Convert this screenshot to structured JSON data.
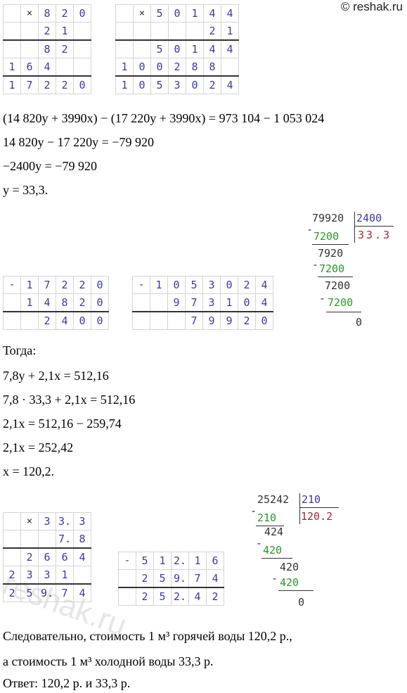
{
  "watermark": "© reshak.ru",
  "watermark_diag": "reshak.ru",
  "mult1": {
    "rows": [
      [
        "",
        "×",
        "8",
        "2",
        "0"
      ],
      [
        "",
        "",
        "2",
        "1",
        ""
      ],
      [
        "",
        "",
        "8",
        "2",
        ""
      ],
      [
        "1",
        "6",
        "4",
        "",
        ""
      ],
      [
        "1",
        "7",
        "2",
        "2",
        "0"
      ]
    ]
  },
  "mult2": {
    "rows": [
      [
        "",
        "×",
        "5",
        "0",
        "1",
        "4",
        "4"
      ],
      [
        "",
        "",
        "",
        "",
        "",
        "2",
        "1"
      ],
      [
        "",
        "",
        "5",
        "0",
        "1",
        "4",
        "4"
      ],
      [
        "1",
        "0",
        "0",
        "2",
        "8",
        "8",
        ""
      ],
      [
        "1",
        "0",
        "5",
        "3",
        "0",
        "2",
        "4"
      ]
    ]
  },
  "eq1": "(14 820y + 3990x) − (17 220y + 3990x) = 973 104 − 1 053 024",
  "eq2": "14 820y − 17 220y = −79 920",
  "eq3": "−2400y = −79 920",
  "eq4": "y = 33,3.",
  "div1": {
    "dividend": "79920",
    "divisor": "2400",
    "quotient": "33.3",
    "s1": "7200",
    "r1": "7920",
    "s2": "7200",
    "r2": "7200",
    "s3": "7200",
    "r3": "0",
    "minus": "-"
  },
  "sub1": {
    "rows": [
      [
        "-",
        "1",
        "7",
        "2",
        "2",
        "0"
      ],
      [
        "",
        "1",
        "4",
        "8",
        "2",
        "0"
      ],
      [
        "",
        "",
        "2",
        "4",
        "0",
        "0"
      ]
    ]
  },
  "sub2": {
    "rows": [
      [
        "-",
        "1",
        "0",
        "5",
        "3",
        "0",
        "2",
        "4"
      ],
      [
        "",
        "",
        "9",
        "7",
        "3",
        "1",
        "0",
        "4"
      ],
      [
        "",
        "",
        "",
        "7",
        "9",
        "9",
        "2",
        "0"
      ]
    ]
  },
  "togda": "Тогда:",
  "eq5": "7,8y + 2,1x = 512,16",
  "eq6": "7,8 · 33,3 + 2,1x = 512,16",
  "eq7": "2,1x = 512,16 − 259,74",
  "eq8": "2,1x = 252,42",
  "eq9": "x = 120,2.",
  "mult3": {
    "rows": [
      [
        "",
        "×",
        "3",
        "3.",
        "3"
      ],
      [
        "",
        "",
        "",
        "7.",
        "8"
      ],
      [
        "",
        "2",
        "6",
        "6",
        "4"
      ],
      [
        "2",
        "3",
        "3",
        "1",
        ""
      ],
      [
        "2",
        "5",
        "9.",
        "7",
        "4"
      ]
    ]
  },
  "sub3": {
    "rows": [
      [
        "-",
        "5",
        "1",
        "2.",
        "1",
        "6"
      ],
      [
        "",
        "2",
        "5",
        "9.",
        "7",
        "4"
      ],
      [
        "",
        "2",
        "5",
        "2.",
        "4",
        "2"
      ]
    ]
  },
  "div2": {
    "dividend": "25242",
    "divisor": "210",
    "quotient": "120.2",
    "s1": "210",
    "r1": "424",
    "s2": "420",
    "r2": "420",
    "s3": "420",
    "r3": "0",
    "minus": "-"
  },
  "concl1": "Следовательно, стоимость 1 м³ горячей воды 120,2 р.,",
  "concl2": "а стоимость 1 м³ холодной воды 33,3 р.",
  "answer": "Ответ: 120,2 р. и 33,3 р."
}
